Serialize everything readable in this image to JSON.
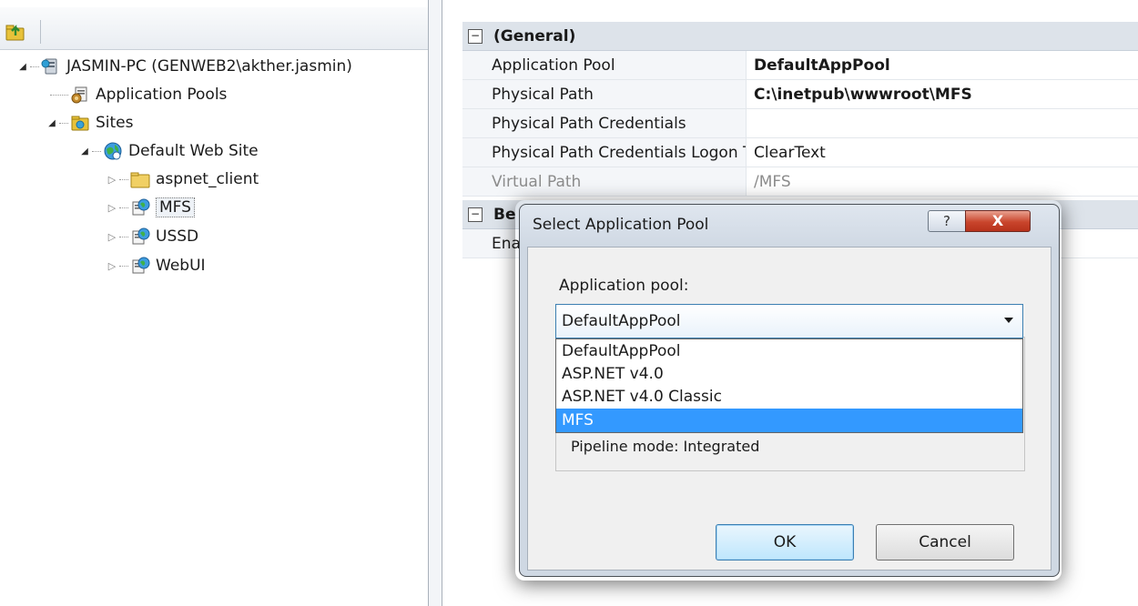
{
  "tree": {
    "root_label": "JASMIN-PC (GENWEB2\\akther.jasmin)",
    "app_pools_label": "Application Pools",
    "sites_label": "Sites",
    "default_site_label": "Default Web Site",
    "children": [
      "aspnet_client",
      "MFS",
      "USSD",
      "WebUI"
    ]
  },
  "properties": {
    "general_label": "(General)",
    "rows": [
      {
        "name": "Application Pool",
        "value": "DefaultAppPool"
      },
      {
        "name": "Physical Path",
        "value": "C:\\inetpub\\wwwroot\\MFS"
      },
      {
        "name": "Physical Path Credentials",
        "value": ""
      },
      {
        "name": "Physical Path Credentials Logon T",
        "value": "ClearText"
      },
      {
        "name": "Virtual Path",
        "value": "/MFS"
      }
    ],
    "behavior_label": "Be",
    "enabled_label": "Ena"
  },
  "dialog": {
    "title": "Select Application Pool",
    "help_glyph": "?",
    "close_glyph": "X",
    "pool_label": "Application pool:",
    "selected": "DefaultAppPool",
    "options": [
      "DefaultAppPool",
      "ASP.NET v4.0",
      "ASP.NET v4.0 Classic",
      "MFS"
    ],
    "highlighted_option": "MFS",
    "pipeline_mode": "Pipeline mode: Integrated",
    "ok_label": "OK",
    "cancel_label": "Cancel"
  },
  "colors": {
    "highlight": "#3399ff",
    "close_button": "#c9452c",
    "category_row": "#dde3ea"
  }
}
